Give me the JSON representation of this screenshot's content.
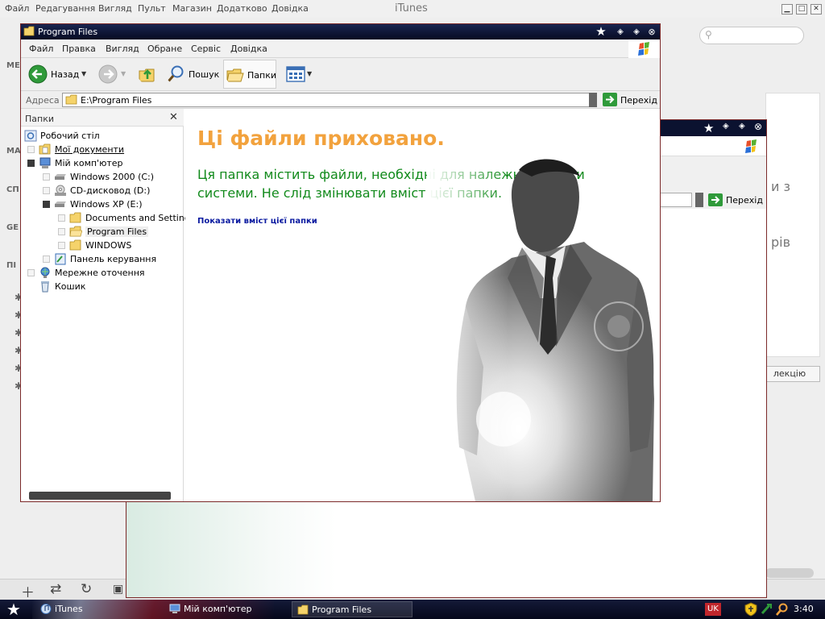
{
  "itunes": {
    "title": "iTunes",
    "menu": [
      "Файл",
      "Редагування",
      "Вигляд",
      "Пульт",
      "Магазин",
      "Додатково",
      "Довідка"
    ],
    "sidebar_headers": [
      "МЕ",
      "МА",
      "СП",
      "GE",
      "ПІ"
    ],
    "right_text_1": "и з",
    "right_text_2": "рів",
    "collection_button": "лекцію"
  },
  "window": {
    "title": "Program Files",
    "menu": [
      "Файл",
      "Правка",
      "Вигляд",
      "Обране",
      "Сервіс",
      "Довідка"
    ],
    "toolbar": {
      "back_label": "Назад",
      "search_label": "Пошук",
      "folders_label": "Папки"
    },
    "address": {
      "label": "Адреса",
      "value": "E:\\Program Files",
      "go_label": "Перехід"
    },
    "folders_pane": {
      "header": "Папки",
      "items": [
        {
          "label": "Робочий стіл"
        },
        {
          "label": "Мої документи"
        },
        {
          "label": "Мій комп'ютер"
        },
        {
          "label": "Windows 2000 (C:)"
        },
        {
          "label": "CD-дисковод (D:)"
        },
        {
          "label": "Windows XP (E:)"
        },
        {
          "label": "Documents and Settings"
        },
        {
          "label": "Program Files"
        },
        {
          "label": "WINDOWS"
        },
        {
          "label": "Панель керування"
        },
        {
          "label": "Мережне оточення"
        },
        {
          "label": "Кошик"
        }
      ]
    },
    "content": {
      "title": "Ці файли приховано.",
      "message": "Ця папка містить файли, необхідні для належної роботи системи. Не слід змінювати вміст цієї папки.",
      "link": "Показати вміст цієї папки"
    }
  },
  "window2": {
    "go_label": "Перехід"
  },
  "taskbar": {
    "tasks": [
      {
        "label": "iTunes"
      },
      {
        "label": "Мій комп'ютер"
      },
      {
        "label": "Program Files"
      }
    ],
    "language": "UK",
    "clock": "3:40"
  },
  "colors": {
    "title_orange": "#f2a23d",
    "message_green": "#118a1b",
    "link_blue": "#0a1aa0",
    "titlebar_navy": "#0b1230"
  }
}
